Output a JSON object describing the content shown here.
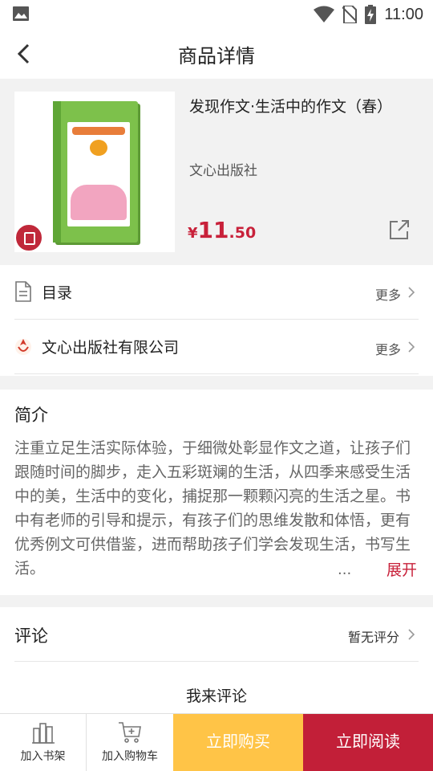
{
  "status_bar": {
    "time": "11:00"
  },
  "header": {
    "title": "商品详情"
  },
  "product": {
    "title": "发现作文·生活中的作文（春）",
    "publisher": "文心出版社",
    "price_currency": "¥",
    "price_integer": "11",
    "price_decimal": ".50"
  },
  "links": [
    {
      "label": "目录",
      "more": "更多"
    },
    {
      "label": "文心出版社有限公司",
      "more": "更多"
    }
  ],
  "intro": {
    "heading": "简介",
    "text": "注重立足生活实际体验，于细微处彰显作文之道，让孩子们跟随时间的脚步，走入五彩斑斓的生活，从四季来感受生活中的美，生活中的变化，捕捉那一颗颗闪亮的生活之星。书中有老师的引导和提示，有孩子们的思维发散和体悟，更有优秀例文可供借鉴，进而帮助孩子们学会发现生活，书写生活。",
    "ellipsis": "...",
    "expand": "展开"
  },
  "review": {
    "heading": "评论",
    "score": "暂无评分",
    "write": "我来评论"
  },
  "bottom": {
    "bookshelf": "加入书架",
    "cart": "加入购物车",
    "buy": "立即购买",
    "read": "立即阅读"
  },
  "colors": {
    "accent": "#c21f38",
    "buy": "#ffc447"
  }
}
